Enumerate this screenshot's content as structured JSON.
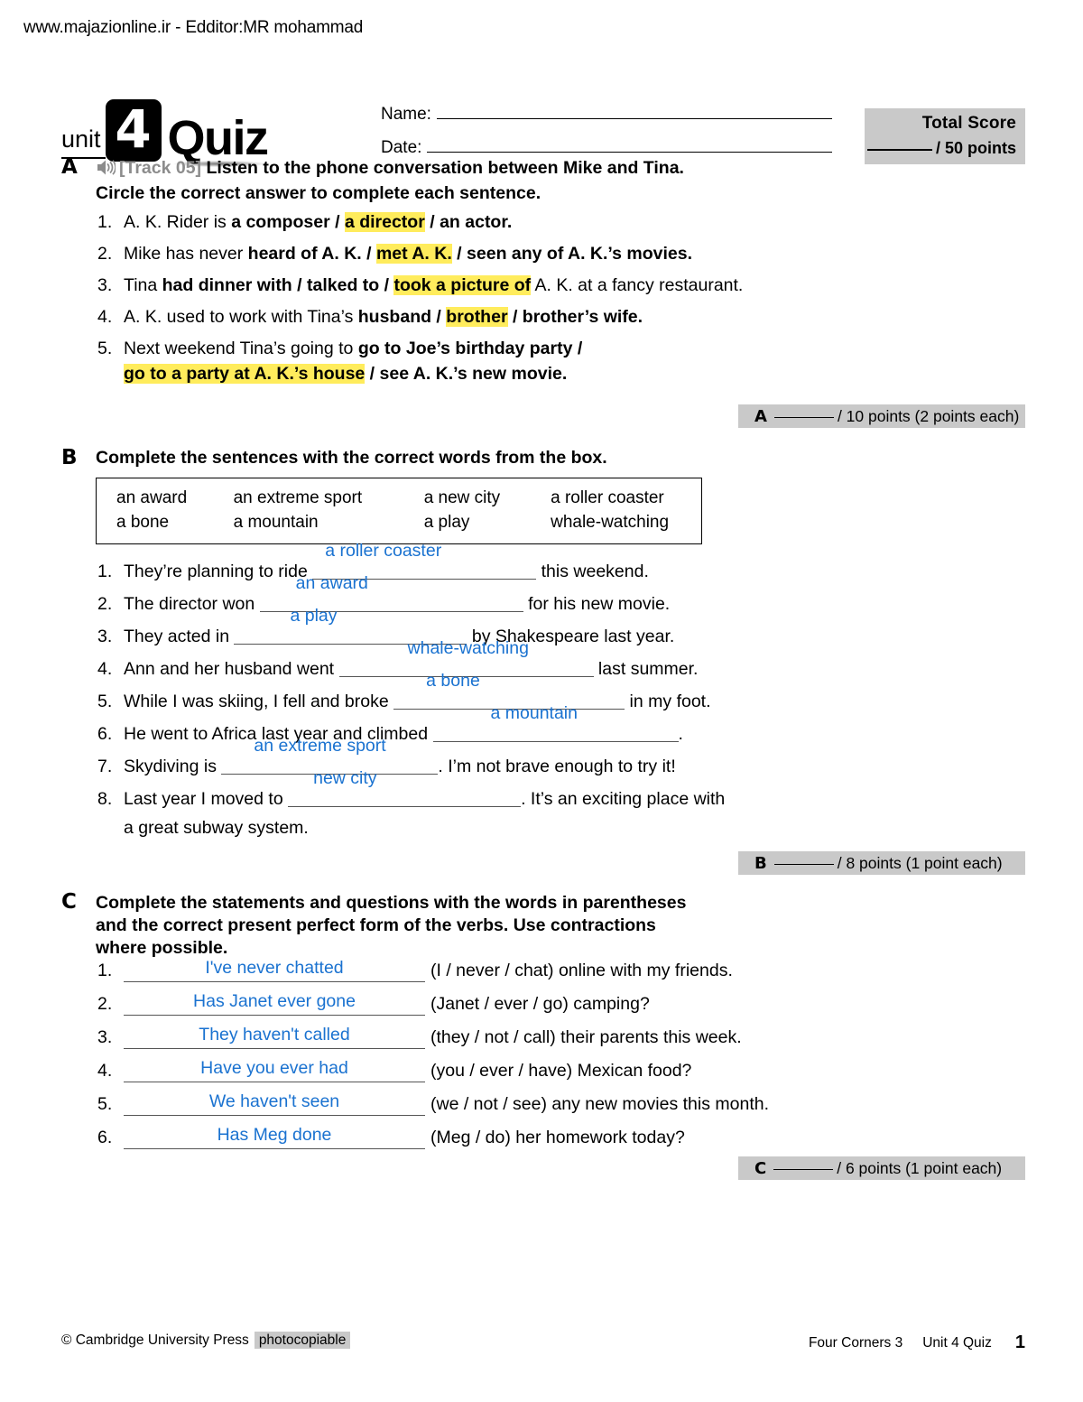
{
  "watermark": "www.majazionline.ir - Edditor:MR mohammad",
  "header": {
    "unit_label": "unit",
    "unit_number": "4",
    "quiz_label": "Quiz",
    "name_label": "Name:",
    "date_label": "Date:",
    "total_score_title": "Total Score",
    "total_score_points": "/ 50 points"
  },
  "sections": [
    {
      "letter": "A",
      "track_label": "[Track 05]",
      "icon": "speaker-icon",
      "instructions_line1": "Listen to the phone conversation between Mike and Tina.",
      "instructions_line2": "Circle the correct answer to complete each sentence.",
      "score": {
        "letter": "A",
        "points": "/ 10 points (2 points each)"
      },
      "items": [
        {
          "num": "1.",
          "pre": "A. K. Rider is ",
          "opt1": "a composer",
          "sep1": " / ",
          "opt2_highlight": "a director",
          "sep2": " / ",
          "opt3": "an actor.",
          "post": ""
        },
        {
          "num": "2.",
          "pre": "Mike has never ",
          "opt1": "heard of A. K.",
          "sep1": " / ",
          "opt2_highlight": "met A. K.",
          "sep2": " / ",
          "opt3": "seen any of A. K.’s movies.",
          "post": ""
        },
        {
          "num": "3.",
          "pre": "Tina ",
          "opt1": "had dinner with",
          "sep1": " / ",
          "opt1b": "talked to",
          "sep1b": " / ",
          "opt2_highlight": "took a picture of",
          "post": " A. K. at a fancy restaurant."
        },
        {
          "num": "4.",
          "pre": "A. K. used to work with Tina’s ",
          "opt1": "husband",
          "sep1": " / ",
          "opt2_highlight": "brother",
          "sep2": " / ",
          "opt3": "brother’s wife.",
          "post": ""
        },
        {
          "num": "5.",
          "pre": "Next weekend Tina’s going to ",
          "opt1": "go to Joe’s birthday party /",
          "opt2_highlight": "go to a party at A. K.’s house",
          "sep2": " / ",
          "opt3": "see A. K.’s new movie.",
          "post": ""
        }
      ]
    },
    {
      "letter": "B",
      "instructions_line1": "Complete the sentences with the correct words from the box.",
      "score": {
        "letter": "B",
        "points": "/ 8 points (1 point each)"
      },
      "wordbox": [
        [
          "an award",
          "an extreme sport",
          "a new city",
          "a roller coaster"
        ],
        [
          "a bone",
          "a mountain",
          "a play",
          "whale-watching"
        ]
      ],
      "items": [
        {
          "num": "1.",
          "pre": "They’re planning to ride ",
          "answer": "a roller coaster",
          "post": " this weekend.",
          "line_width": 248,
          "align": "left"
        },
        {
          "num": "2.",
          "pre": "The director won ",
          "answer": "an award",
          "post": " for his new movie.",
          "line_width": 292,
          "align": "left"
        },
        {
          "num": "3.",
          "pre": "They acted in ",
          "answer": "a play",
          "post": " by Shakespeare last year.",
          "line_width": 258,
          "align": "left"
        },
        {
          "num": "4.",
          "pre": "Ann and her husband went ",
          "answer": "whale-watching",
          "post": " last summer.",
          "line_width": 282,
          "align": "left"
        },
        {
          "num": "5.",
          "pre": "While I was skiing, I fell and broke ",
          "answer": "a bone",
          "post": " in my foot.",
          "line_width": 256,
          "align": "left"
        },
        {
          "num": "6.",
          "pre": "He went to Africa last year and climbed ",
          "answer": "a mountain",
          "post": ".",
          "line_width": 272,
          "align": "left"
        },
        {
          "num": "7.",
          "pre": "Skydiving is ",
          "answer": "an extreme sport",
          "post": ". I’m not brave enough to try it!",
          "line_width": 240,
          "align": "left"
        },
        {
          "num": "8.",
          "pre": "Last year I moved to ",
          "answer": "new city",
          "post": ". It’s an exciting place with",
          "line_width": 258,
          "align": "left"
        }
      ],
      "item8_continuation": "a great subway system."
    },
    {
      "letter": "C",
      "instructions_line1": "Complete the statements and questions with the words in parentheses",
      "instructions_line2": "and the correct present perfect form of the verbs. Use contractions",
      "instructions_line3": "where possible.",
      "score": {
        "letter": "C",
        "points": "/ 6 points (1 point each)"
      },
      "items": [
        {
          "num": "1.",
          "answer": "I've never chatted",
          "tail": "(I / never / chat) online with my friends."
        },
        {
          "num": "2.",
          "answer": "Has Janet ever gone",
          "tail": "(Janet / ever / go) camping?"
        },
        {
          "num": "3.",
          "answer": "They haven't called",
          "tail": "(they / not / call) their parents this week."
        },
        {
          "num": "4.",
          "answer": "Have you ever had",
          "tail": "(you / ever / have) Mexican food?"
        },
        {
          "num": "5.",
          "answer": "We haven't seen",
          "tail": "(we / not / see) any new movies this month."
        },
        {
          "num": "6.",
          "answer": "Has Meg done",
          "tail": "(Meg / do) her homework today?"
        }
      ]
    }
  ],
  "footer": {
    "copyright": "© Cambridge University Press",
    "photocopiable": "photocopiable",
    "book": "Four Corners 3",
    "unit": "Unit 4 Quiz",
    "page": "1"
  },
  "colors": {
    "highlight": "#ffec5c",
    "answer_blue": "#1a72d0",
    "score_gray": "#c9c9c9",
    "track_gray": "#8c8c8c"
  }
}
